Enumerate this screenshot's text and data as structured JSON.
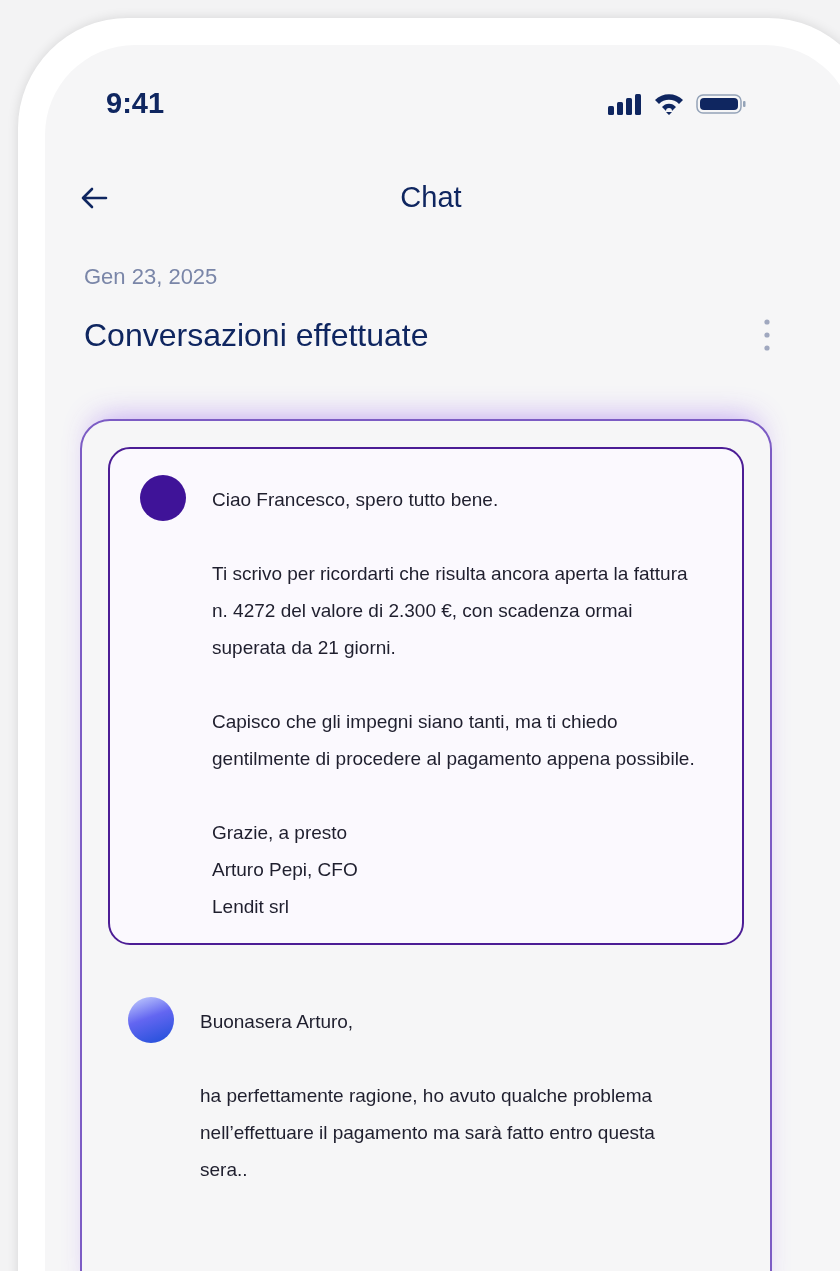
{
  "status_bar": {
    "time": "9:41"
  },
  "nav": {
    "title": "Chat"
  },
  "date": "Gen 23, 2025",
  "heading": "Conversazioni effettuate",
  "messages": [
    {
      "kind": "sent",
      "paragraphs": [
        "Ciao Francesco, spero tutto bene.",
        "Ti scrivo per ricordarti che risulta ancora aperta la fattura n. 4272 del valore di 2.300 €, con scadenza ormai superata da 21 giorni.",
        "Capisco che gli impegni siano tanti, ma ti chiedo gentilmente di procedere al pagamento appena possibile.",
        "Grazie, a presto\nArturo Pepi, CFO\nLendit srl"
      ]
    },
    {
      "kind": "received",
      "paragraphs": [
        "Buonasera Arturo,",
        "ha perfettamente ragione, ho avuto qualche problema nell’effettuare il pagamento ma sarà fatto entro questa sera.."
      ]
    }
  ]
}
